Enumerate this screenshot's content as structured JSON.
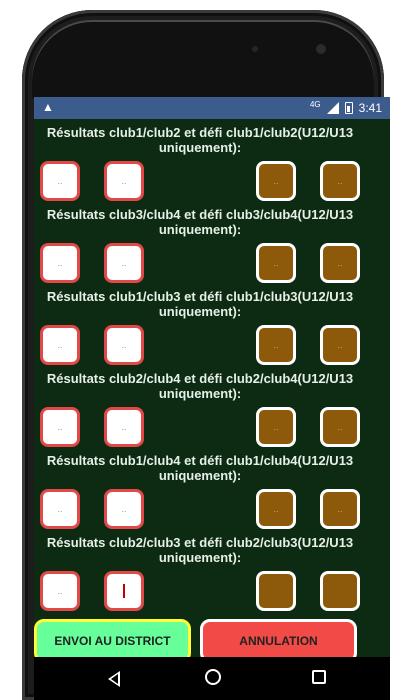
{
  "status_bar": {
    "left_icon": "warning-triangle-icon",
    "network": "4G",
    "time": "3:41"
  },
  "sections": [
    {
      "title": "Résultats club1/club2 et défi club1/club2(U12/U13 uniquement):",
      "scores": [
        "..",
        "..",
        "..",
        ".."
      ]
    },
    {
      "title": "Résultats club3/club4 et défi club3/club4(U12/U13 uniquement):",
      "scores": [
        "..",
        "..",
        "..",
        ".."
      ]
    },
    {
      "title": "Résultats club1/club3 et défi club1/club3(U12/U13 uniquement):",
      "scores": [
        "..",
        "..",
        "..",
        ".."
      ]
    },
    {
      "title": "Résultats club2/club4 et défi club2/club4(U12/U13 uniquement):",
      "scores": [
        "..",
        "..",
        "..",
        ".."
      ]
    },
    {
      "title": "Résultats club1/club4 et défi club1/club4(U12/U13 uniquement):",
      "scores": [
        "..",
        "..",
        "..",
        ".."
      ]
    },
    {
      "title": "Résultats club2/club3 et défi club2/club3(U12/U13 uniquement):",
      "scores": [
        "..",
        "",
        "",
        ""
      ]
    }
  ],
  "buttons": {
    "envoi": "ENVOI AU DISTRICT",
    "annulation": "ANNULATION"
  },
  "nav": {
    "back": "back-icon",
    "home": "home-icon",
    "recents": "recents-icon"
  },
  "colors": {
    "background": "#0d2a13",
    "statusbar": "#3d5c8e",
    "score_border_red": "#e14848",
    "score_brown": "#8c5a0a",
    "envoi_bg": "#66ff99",
    "envoi_border": "#ffff33",
    "annul_bg": "#f24a47"
  }
}
